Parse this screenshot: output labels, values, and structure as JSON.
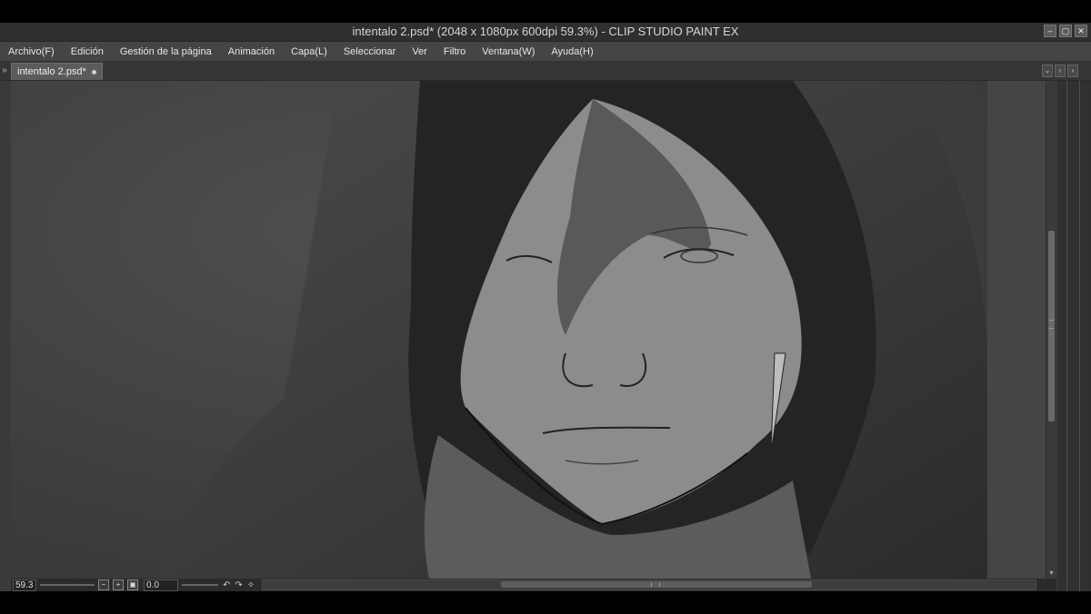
{
  "window": {
    "title": "intentalo 2.psd* (2048 x 1080px 600dpi 59.3%)  - CLIP STUDIO PAINT EX",
    "controls": [
      "–",
      "▢",
      "✕"
    ]
  },
  "menu": {
    "items": [
      "Archivo(F)",
      "Edición",
      "Gestión de la página",
      "Animación",
      "Capa(L)",
      "Seleccionar",
      "Ver",
      "Filtro",
      "Ventana(W)",
      "Ayuda(H)"
    ]
  },
  "tabs": {
    "document_tab": "intentalo 2.psd*"
  },
  "status": {
    "zoom": "59.3",
    "rotation": "0.0"
  },
  "colors": {
    "accent": "#6a6a6a"
  }
}
